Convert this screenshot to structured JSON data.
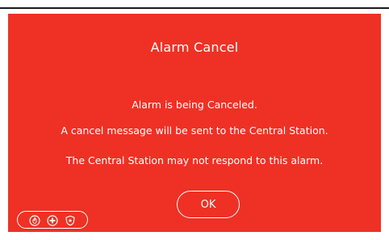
{
  "dialog": {
    "title": "Alarm Cancel",
    "message_line1": "Alarm is being Canceled.",
    "message_line2": "A cancel message will be sent to the Central Station.",
    "message_line3": "The Central Station may not respond to this alarm.",
    "ok_label": "OK"
  },
  "emergency": {
    "icons": [
      "fire-icon",
      "medical-icon",
      "police-icon"
    ]
  },
  "colors": {
    "panel_background": "#ee3124",
    "text": "#ffffff"
  }
}
